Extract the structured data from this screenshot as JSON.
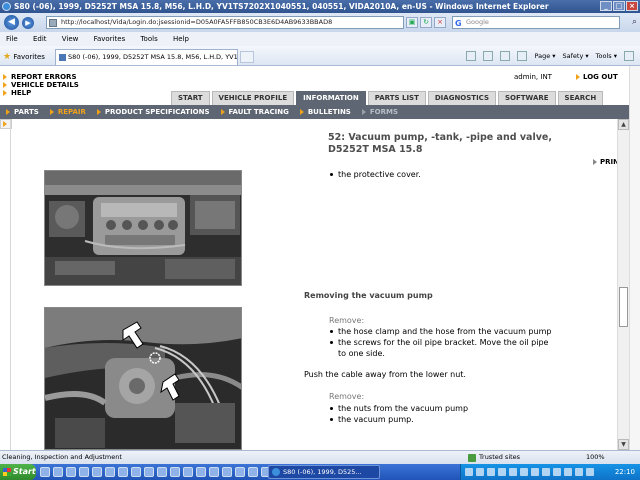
{
  "window": {
    "title": "S80 (-06), 1999, D5252T MSA 15.8, M56, L.H.D, YV1TS7202X1040551, 040551, VIDA2010A, en-US - Windows Internet Explorer"
  },
  "address_bar": {
    "url": "http://localhost/Vida/Login.do;jsessionid=D05A0FA5FFB850CB3E6D4AB9633BBAD8",
    "search_placeholder": "Google"
  },
  "menu": [
    "File",
    "Edit",
    "View",
    "Favorites",
    "Tools",
    "Help"
  ],
  "favorites_bar": {
    "favorites_label": "Favorites",
    "tab_title": "S80 (-06), 1999, D5252T MSA 15.8, M56, L.H.D, YV1...",
    "command_items": [
      "Page ▾",
      "Safety ▾",
      "Tools ▾"
    ]
  },
  "app": {
    "left_links": [
      "REPORT ERRORS",
      "VEHICLE DETAILS",
      "HELP"
    ],
    "user": "admin, INT",
    "logout_label": "LOG OUT",
    "top_tabs": [
      "START",
      "VEHICLE PROFILE",
      "INFORMATION",
      "PARTS LIST",
      "DIAGNOSTICS",
      "SOFTWARE",
      "SEARCH"
    ],
    "active_top_tab": "INFORMATION",
    "sub_nav": [
      "PARTS",
      "REPAIR",
      "PRODUCT SPECIFICATIONS",
      "FAULT TRACING",
      "BULLETINS",
      "FORMS"
    ]
  },
  "document": {
    "title": "52: Vacuum pump, -tank, -pipe and valve, D5252T MSA 15.8",
    "print_label": "PRINT",
    "first_bullet": "the protective cover.",
    "section_heading": "Removing the vacuum pump",
    "remove_label_1": "Remove:",
    "remove_bullets_1": [
      "the hose clamp and the hose from the vacuum pump",
      "the screws for the oil pipe bracket. Move the oil pipe to one side."
    ],
    "paragraph": "Push the cable away from the lower nut.",
    "remove_label_2": "Remove:",
    "remove_bullets_2": [
      "the nuts from the vacuum pump",
      "the vacuum pump."
    ]
  },
  "status_bar": {
    "text": "Cleaning, Inspection and Adjustment",
    "zone": "Trusted sites",
    "zoom": "100%"
  },
  "taskbar": {
    "start_label": "Start",
    "task_button": "S80 (-06), 1999, D525...",
    "clock": "22:10"
  }
}
